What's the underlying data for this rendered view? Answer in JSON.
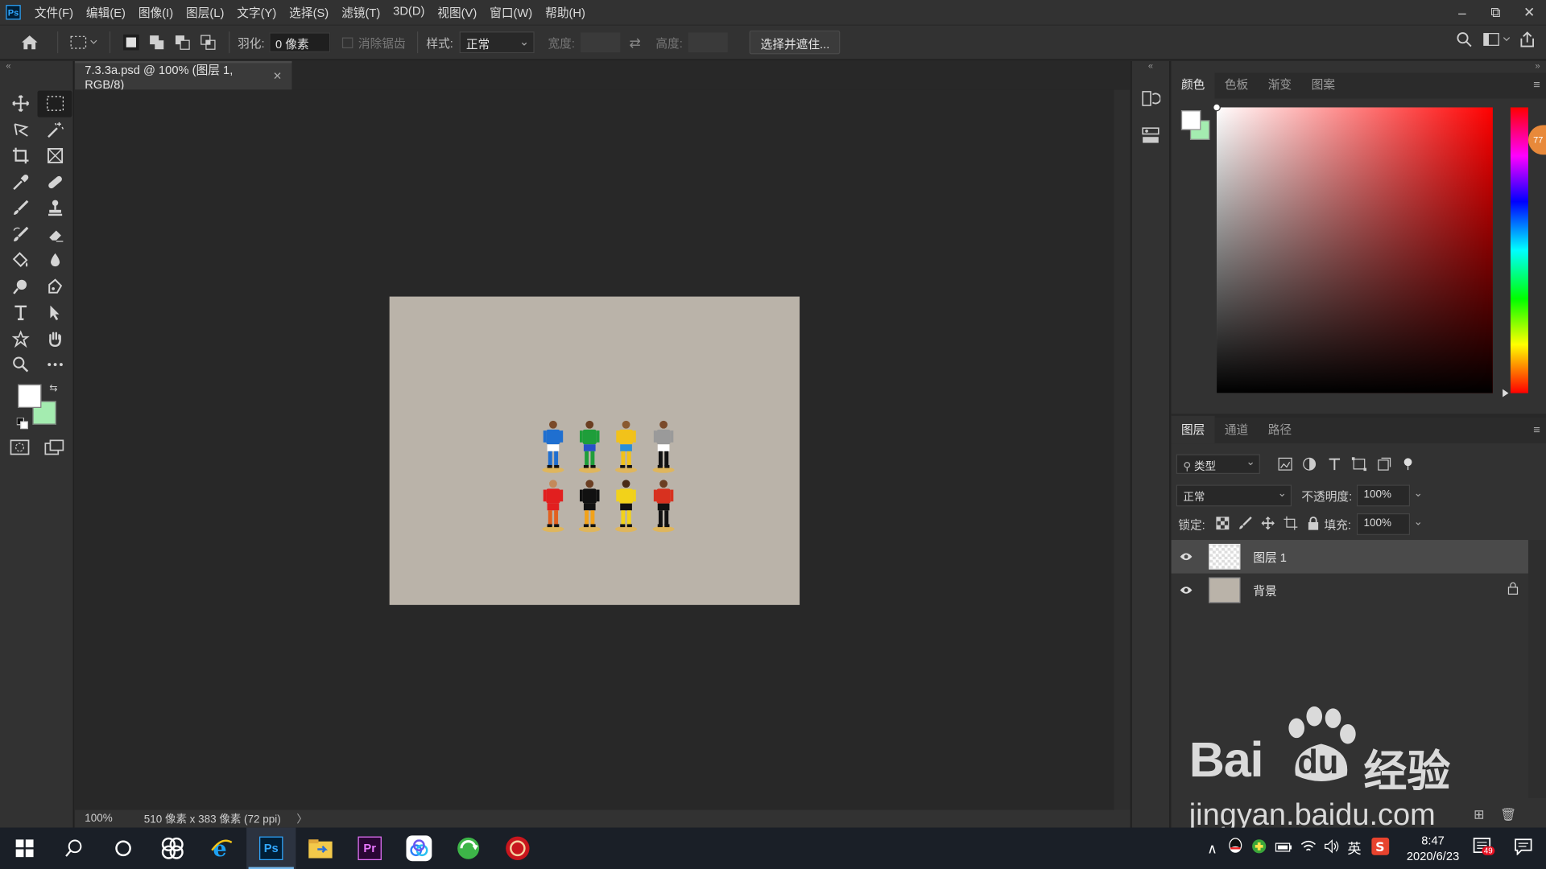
{
  "app": {
    "menu": [
      "文件(F)",
      "编辑(E)",
      "图像(I)",
      "图层(L)",
      "文字(Y)",
      "选择(S)",
      "滤镜(T)",
      "3D(D)",
      "视图(V)",
      "窗口(W)",
      "帮助(H)"
    ],
    "window_controls": {
      "minimize": "–",
      "restore": "⧉",
      "close": "✕"
    }
  },
  "options": {
    "feather_label": "羽化:",
    "feather_value": "0 像素",
    "antialias_label": "消除锯齿",
    "style_label": "样式:",
    "style_value": "正常",
    "width_label": "宽度:",
    "height_label": "高度:",
    "select_mask_button": "选择并遮住..."
  },
  "document": {
    "tab_title": "7.3.3a.psd @ 100% (图层 1, RGB/8)",
    "zoom": "100%",
    "doc_info": "510 像素 x 383 像素 (72 ppi)",
    "canvas_color": "#bab3a9"
  },
  "colors": {
    "foreground": "#ffffff",
    "background": "#a4ecb0",
    "accent": "#31a8ff"
  },
  "color_panel": {
    "tabs": [
      "颜色",
      "色板",
      "渐变",
      "图案"
    ],
    "active_tab": "颜色",
    "badge": "77"
  },
  "layers_panel": {
    "tabs": [
      "图层",
      "通道",
      "路径"
    ],
    "active_tab": "图层",
    "filter_kind": "类型",
    "blend_mode": "正常",
    "opacity_label": "不透明度:",
    "opacity_value": "100%",
    "lock_label": "锁定:",
    "fill_label": "填充:",
    "fill_value": "100%",
    "layers": [
      {
        "name": "图层 1",
        "selected": true,
        "locked": false
      },
      {
        "name": "背景",
        "selected": false,
        "locked": true
      }
    ]
  },
  "figures": [
    {
      "head": "#7a4a2a",
      "shirt": "#1f6fd0",
      "shorts": "#ffffff",
      "legs": "#1f6fd0"
    },
    {
      "head": "#6b3e22",
      "shirt": "#1e9e3a",
      "shorts": "#2850c8",
      "legs": "#1e9e3a"
    },
    {
      "head": "#8a5a30",
      "shirt": "#f2c21a",
      "shorts": "#2a8fd8",
      "legs": "#f2c21a"
    },
    {
      "head": "#7a4a2a",
      "shirt": "#9a9a9a",
      "shorts": "#ffffff",
      "legs": "#111111"
    },
    {
      "head": "#c48a5a",
      "shirt": "#e21f1f",
      "shorts": "#e21f1f",
      "legs": "#e2601f"
    },
    {
      "head": "#6b3e22",
      "shirt": "#111111",
      "shorts": "#111111",
      "legs": "#f2a21a"
    },
    {
      "head": "#4a2a16",
      "shirt": "#f2d21a",
      "shorts": "#111111",
      "legs": "#f2d21a"
    },
    {
      "head": "#6b3e22",
      "shirt": "#d8311f",
      "shorts": "#111111",
      "legs": "#111111"
    }
  ],
  "watermark": {
    "brand_a": "Bai",
    "brand_b": "du",
    "brand_cn": "经验",
    "url": "jingyan.baidu.com"
  },
  "taskbar": {
    "time": "8:47",
    "date": "2020/6/23",
    "ime": "英",
    "notification_count": "49"
  }
}
